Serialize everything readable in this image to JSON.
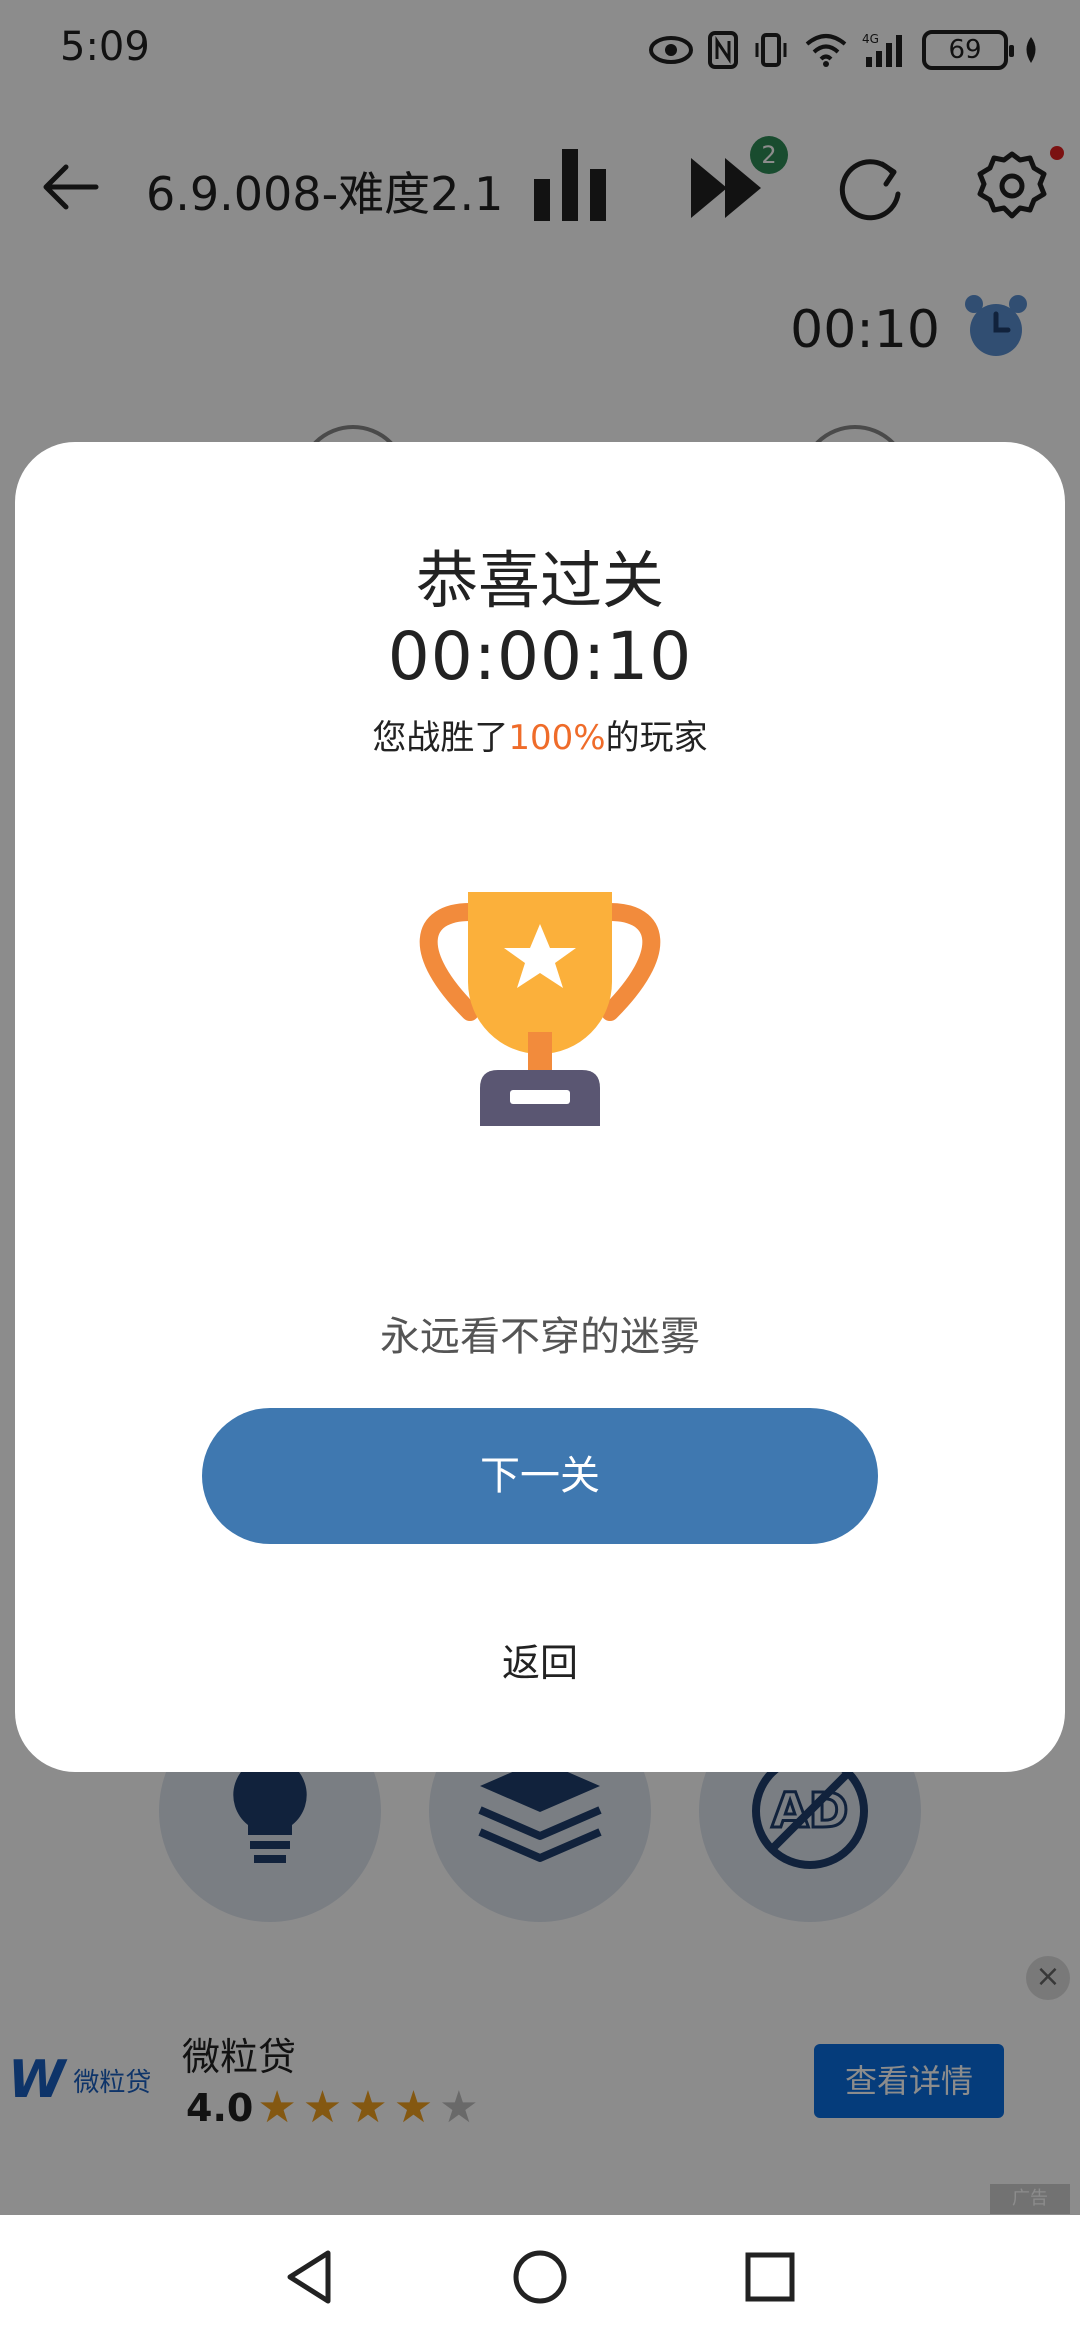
{
  "status_bar": {
    "time": "5:09",
    "battery": "69"
  },
  "toolbar": {
    "title": "6.9.008-难度2.1",
    "skip_badge": "2"
  },
  "game": {
    "timer": "00:10"
  },
  "dialog": {
    "title": "恭喜过关",
    "time": "00:00:10",
    "beat_prefix": "您战胜了",
    "beat_percent": "100%",
    "beat_suffix": "的玩家",
    "level_name": "永远看不穿的迷雾",
    "next_label": "下一关",
    "back_label": "返回"
  },
  "ad": {
    "logo_text": "微粒贷",
    "name": "微粒贷",
    "rating": "4.0",
    "stars_filled": 4,
    "stars_total": 5,
    "cta": "查看详情",
    "close": "×",
    "tag": "广告"
  },
  "colors": {
    "primary_button": "#3f78b0",
    "highlight": "#ef6c2a",
    "badge": "#2e8b57",
    "ad_cta": "#0a6ee0"
  },
  "icons": [
    "back-arrow-icon",
    "bar-chart-icon",
    "fast-forward-icon",
    "refresh-icon",
    "settings-gear-icon",
    "alarm-clock-icon",
    "trophy-icon",
    "lightbulb-icon",
    "layers-icon",
    "no-ad-icon",
    "nav-back-icon",
    "nav-home-icon",
    "nav-recents-icon"
  ]
}
